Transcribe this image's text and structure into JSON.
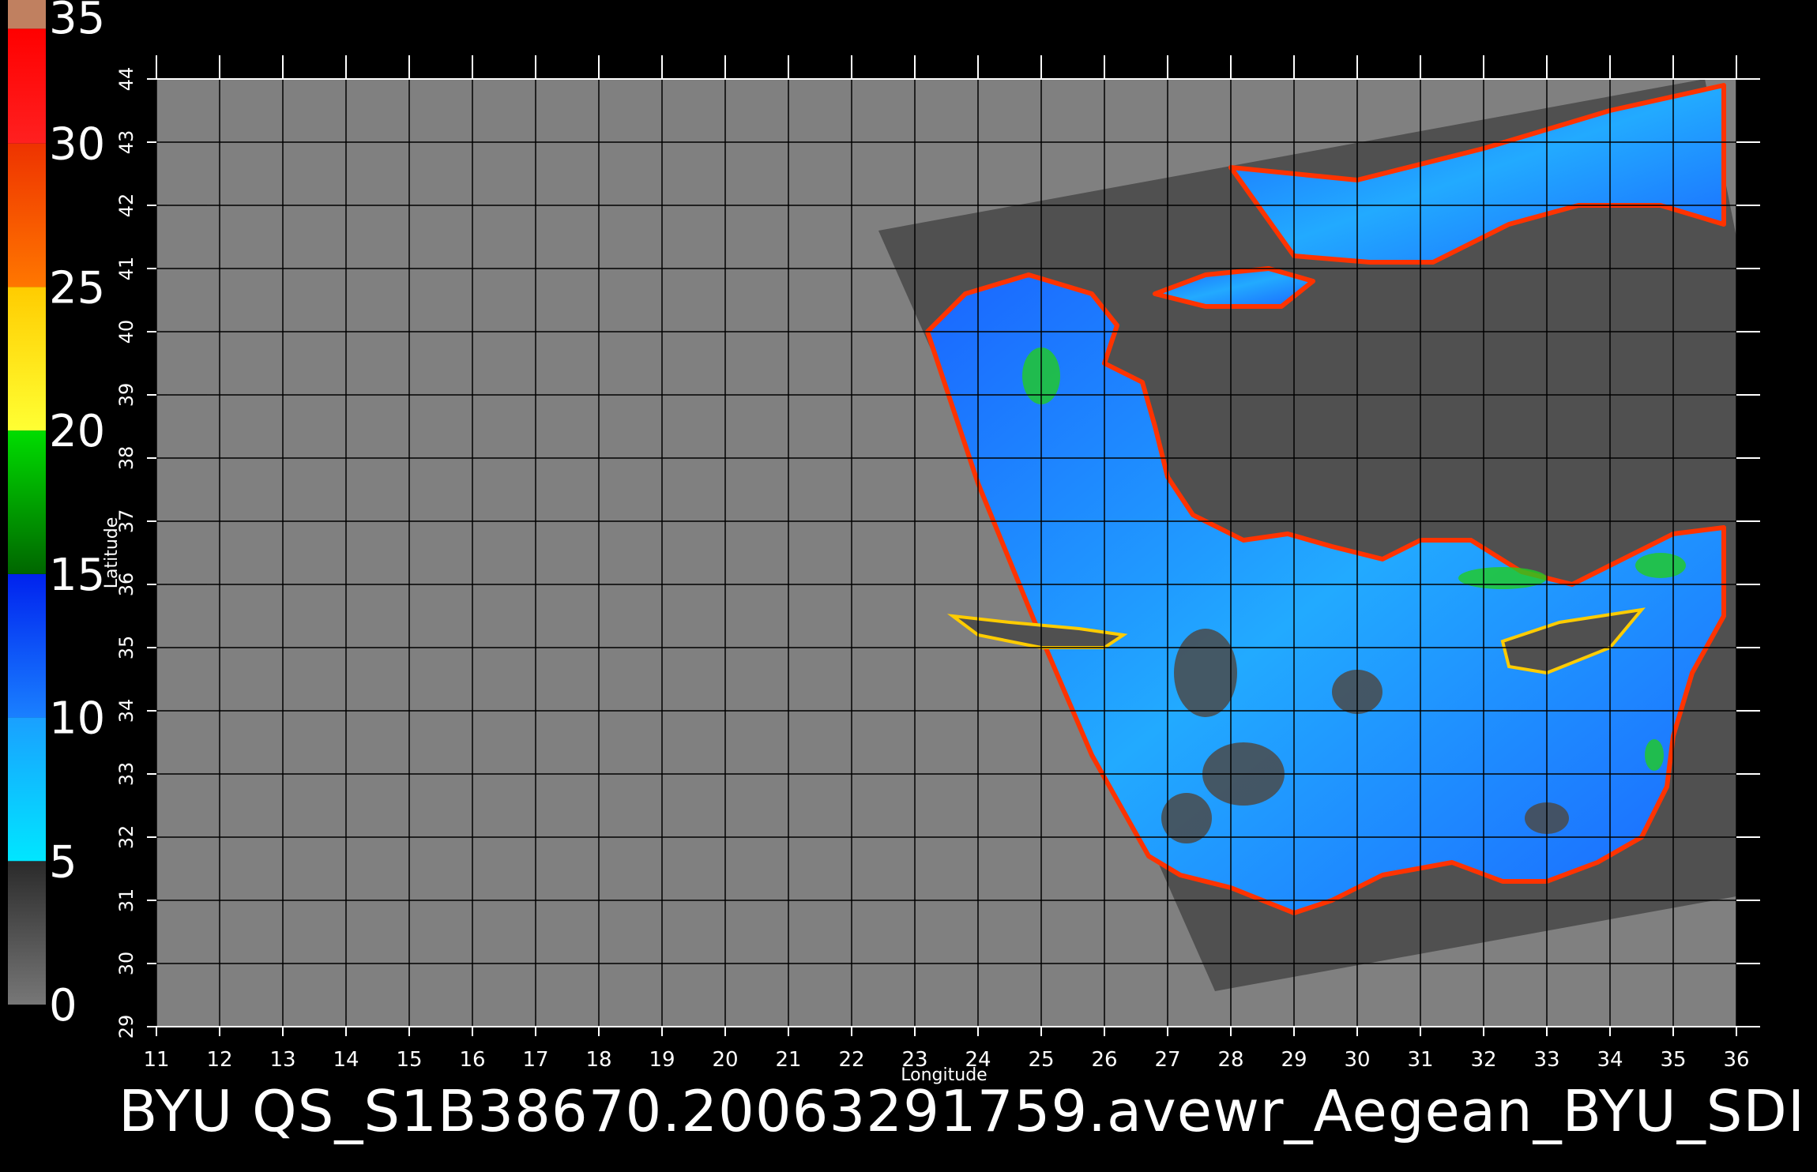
{
  "colorbar": {
    "tick_labels": [
      "35",
      "30",
      "25",
      "20",
      "15",
      "10",
      "5",
      "0"
    ],
    "tick_values": [
      35,
      30,
      25,
      20,
      15,
      10,
      5,
      0
    ],
    "range": [
      0,
      35
    ],
    "segments": [
      {
        "from": 0,
        "to": 5,
        "colors": [
          "#777777",
          "#2a2a2a"
        ]
      },
      {
        "from": 5,
        "to": 10,
        "colors": [
          "#00e6ff",
          "#1aa0ff"
        ]
      },
      {
        "from": 10,
        "to": 15,
        "colors": [
          "#1a80ff",
          "#0022ee"
        ]
      },
      {
        "from": 15,
        "to": 20,
        "colors": [
          "#006600",
          "#00dd00"
        ]
      },
      {
        "from": 20,
        "to": 25,
        "colors": [
          "#ffff33",
          "#ffcc00"
        ]
      },
      {
        "from": 25,
        "to": 30,
        "colors": [
          "#ff7700",
          "#ee3300"
        ]
      },
      {
        "from": 30,
        "to": 34,
        "colors": [
          "#ff2020",
          "#ff0000"
        ]
      },
      {
        "from": 34,
        "to": 35,
        "colors": [
          "#c08060",
          "#c08060"
        ]
      }
    ]
  },
  "map": {
    "x_label": "Longitude",
    "y_label": "Latitude",
    "lon_range": [
      11,
      36
    ],
    "lat_range": [
      29,
      44
    ],
    "lon_ticks": [
      "11",
      "12",
      "13",
      "14",
      "15",
      "16",
      "17",
      "18",
      "19",
      "20",
      "21",
      "22",
      "23",
      "24",
      "25",
      "26",
      "27",
      "28",
      "29",
      "30",
      "31",
      "32",
      "33",
      "34",
      "35",
      "36"
    ],
    "lat_ticks": [
      "29",
      "30",
      "31",
      "32",
      "33",
      "34",
      "35",
      "36",
      "37",
      "38",
      "39",
      "40",
      "41",
      "42",
      "43",
      "44"
    ],
    "background_color": "#808080",
    "swath_color": "#505050",
    "land_color": "#505050",
    "grid_color": "#000000"
  },
  "caption": "BYU  QS_S1B38670.20063291759.avewr_Aegean_BYU_SDI"
}
